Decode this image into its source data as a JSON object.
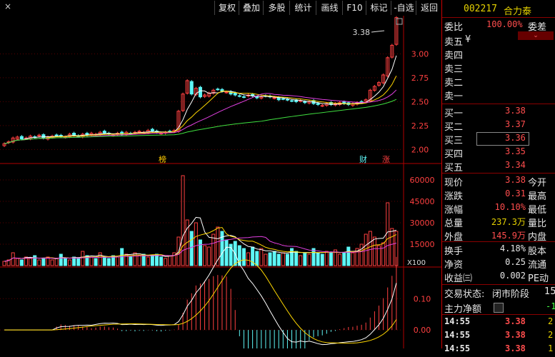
{
  "toolbar": {
    "close_glyph": "×",
    "buttons": [
      "复权",
      "叠加",
      "多股",
      "统计",
      "画线",
      "F10",
      "标记",
      "-自选",
      "返回"
    ]
  },
  "stock": {
    "code": "002217",
    "name": "合力泰"
  },
  "chart_data": [
    {
      "type": "candlestick",
      "panel": "price",
      "y_ticks": [
        "3.00",
        "2.75",
        "2.50",
        "2.25",
        "2.00"
      ],
      "ylim": [
        1.98,
        3.25
      ],
      "annotation_high": "3.38",
      "markers": [
        "榜",
        "财",
        "涨"
      ],
      "close_series": [
        2.06,
        2.08,
        2.12,
        2.13,
        2.11,
        2.12,
        2.14,
        2.13,
        2.15,
        2.12,
        2.13,
        2.14,
        2.15,
        2.14,
        2.13,
        2.16,
        2.15,
        2.14,
        2.16,
        2.15,
        2.17,
        2.16,
        2.18,
        2.17,
        2.16,
        2.15,
        2.17,
        2.16,
        2.18,
        2.17,
        2.18,
        2.19,
        2.18,
        2.2,
        2.19,
        2.18,
        2.17,
        2.18,
        2.19,
        2.2,
        2.4,
        2.58,
        2.72,
        2.58,
        2.64,
        2.55,
        2.57,
        2.59,
        2.62,
        2.63,
        2.61,
        2.6,
        2.58,
        2.57,
        2.56,
        2.55,
        2.57,
        2.56,
        2.54,
        2.55,
        2.56,
        2.55,
        2.54,
        2.52,
        2.53,
        2.52,
        2.51,
        2.5,
        2.51,
        2.49,
        2.5,
        2.48,
        2.47,
        2.46,
        2.48,
        2.47,
        2.48,
        2.49,
        2.48,
        2.47,
        2.48,
        2.49,
        2.5,
        2.52,
        2.62,
        2.66,
        2.7,
        2.78,
        2.96,
        3.09,
        3.38
      ]
    },
    {
      "type": "bar",
      "panel": "volume",
      "y_ticks": [
        "60000",
        "45000",
        "30000",
        "15000"
      ],
      "ylim": [
        0,
        64000
      ],
      "unit_label": "X100",
      "values": [
        3000,
        4000,
        9000,
        5000,
        4000,
        6000,
        5000,
        7000,
        4000,
        5000,
        6000,
        4000,
        5000,
        8000,
        5000,
        4000,
        6000,
        5000,
        10000,
        7000,
        6000,
        5000,
        9000,
        6000,
        5000,
        7000,
        6000,
        12000,
        8000,
        6000,
        9000,
        7000,
        8000,
        6000,
        7000,
        8000,
        6000,
        5000,
        7000,
        9000,
        20000,
        63000,
        32000,
        24000,
        30000,
        18000,
        14000,
        13000,
        22000,
        27000,
        24000,
        18000,
        15000,
        17000,
        14000,
        12000,
        9000,
        13000,
        10000,
        12000,
        8000,
        9000,
        10000,
        8000,
        9000,
        8000,
        12000,
        10000,
        7000,
        9000,
        8000,
        12000,
        9000,
        8000,
        10000,
        9000,
        11000,
        8000,
        9000,
        13000,
        9000,
        12000,
        15000,
        22000,
        24000,
        20000,
        14000,
        16000,
        44000,
        26000,
        24000
      ]
    },
    {
      "type": "line",
      "panel": "indicator",
      "y_ticks": [
        "0.10",
        "0.00"
      ],
      "ylim": [
        -0.05,
        0.16
      ]
    }
  ],
  "quote": {
    "weibi_label": "委比",
    "weibi_value": "100.00%",
    "weicha_label": "委差",
    "sell": [
      {
        "label": "卖五",
        "price": "",
        "extra": "¥"
      },
      {
        "label": "卖四",
        "price": ""
      },
      {
        "label": "卖三",
        "price": ""
      },
      {
        "label": "卖二",
        "price": ""
      },
      {
        "label": "卖一",
        "price": ""
      }
    ],
    "buy": [
      {
        "label": "买一",
        "price": "3.38"
      },
      {
        "label": "买二",
        "price": "3.37"
      },
      {
        "label": "买三",
        "price": "3.36"
      },
      {
        "label": "买四",
        "price": "3.35"
      },
      {
        "label": "买五",
        "price": "3.34"
      }
    ],
    "stats": [
      {
        "l": "现价",
        "v": "3.38",
        "r": "今开",
        "c": "red"
      },
      {
        "l": "涨跌",
        "v": "0.31",
        "r": "最高",
        "c": "red"
      },
      {
        "l": "涨幅",
        "v": "10.10%",
        "r": "最低",
        "c": "red"
      },
      {
        "l": "总量",
        "v": "237.3万",
        "r": "量比",
        "c": "yellow"
      },
      {
        "l": "外盘",
        "v": "145.9万",
        "r": "内盘",
        "c": "red"
      }
    ],
    "stats2": [
      {
        "l": "换手",
        "v": "4.18%",
        "r": "股本",
        "c": "white"
      },
      {
        "l": "净资",
        "v": "0.25",
        "r": "流通",
        "c": "white"
      },
      {
        "l": "收益㈢",
        "v": "0.002",
        "r": "PE动",
        "c": "white"
      }
    ],
    "trade_status_label": "交易状态:",
    "trade_status_value": "闭市阶段",
    "trade_status_extra": "15",
    "net_label": "主力净额",
    "net_value": "-1",
    "ticks": [
      {
        "time": "14:55",
        "price": "3.38",
        "vol": "2."
      },
      {
        "time": "14:55",
        "price": "3.38",
        "vol": "2."
      },
      {
        "time": "14:55",
        "price": "3.38",
        "vol": "1."
      }
    ]
  }
}
